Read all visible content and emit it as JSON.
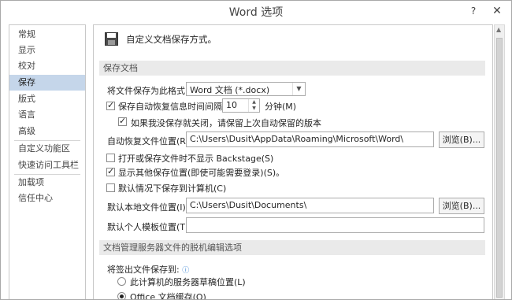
{
  "window": {
    "title": "Word 选项",
    "help_glyph": "?",
    "close_glyph": "✕"
  },
  "nav": {
    "items": [
      {
        "label": "常规"
      },
      {
        "label": "显示"
      },
      {
        "label": "校对"
      },
      {
        "label": "保存"
      },
      {
        "label": "版式"
      },
      {
        "label": "语言"
      },
      {
        "label": "高级"
      },
      {
        "label": "自定义功能区"
      },
      {
        "label": "快速访问工具栏"
      },
      {
        "label": "加载项"
      },
      {
        "label": "信任中心"
      }
    ],
    "selected": "保存"
  },
  "header": {
    "icon": "floppy-disk-icon",
    "text": "自定义文档保存方式。"
  },
  "save_documents": {
    "section_title": "保存文档",
    "format_label": "将文件保存为此格式(F):",
    "format_value": "Word 文档 (*.docx)",
    "autorecover_label": "保存自动恢复信息时间间隔(A)",
    "autorecover_checked": true,
    "autorecover_minutes": "10",
    "minutes_label": "分钟(M)",
    "keep_last_label": "如果我没保存就关闭，请保留上次自动保留的版本",
    "keep_last_checked": true,
    "autorecover_path_label": "自动恢复文件位置(R):",
    "autorecover_path_value": "C:\\Users\\Dusit\\AppData\\Roaming\\Microsoft\\Word\\",
    "browse_label": "浏览(B)...",
    "no_backstage_label": "打开或保存文件时不显示 Backstage(S)",
    "no_backstage_checked": false,
    "show_additional_label": "显示其他保存位置(即使可能需要登录)(S)。",
    "show_additional_checked": true,
    "save_to_computer_label": "默认情况下保存到计算机(C)",
    "save_to_computer_checked": false,
    "local_path_label": "默认本地文件位置(I):",
    "local_path_value": "C:\\Users\\Dusit\\Documents\\",
    "browse2_label": "浏览(B)...",
    "template_label": "默认个人模板位置(T):",
    "template_value": ""
  },
  "offline": {
    "section_title": "文档管理服务器文件的脱机编辑选项",
    "checkout_label": "将签出文件保存到:",
    "info_glyph": "ⓘ",
    "option_server_drafts": "此计算机的服务器草稿位置(L)",
    "option_server_drafts_selected": false,
    "option_office_cache": "Office 文档缓存(O)",
    "option_office_cache_selected": true
  },
  "colors": {
    "selected_nav": "#c5d6ea",
    "section_bg": "#eaeaea",
    "info": "#2b7bd1"
  }
}
